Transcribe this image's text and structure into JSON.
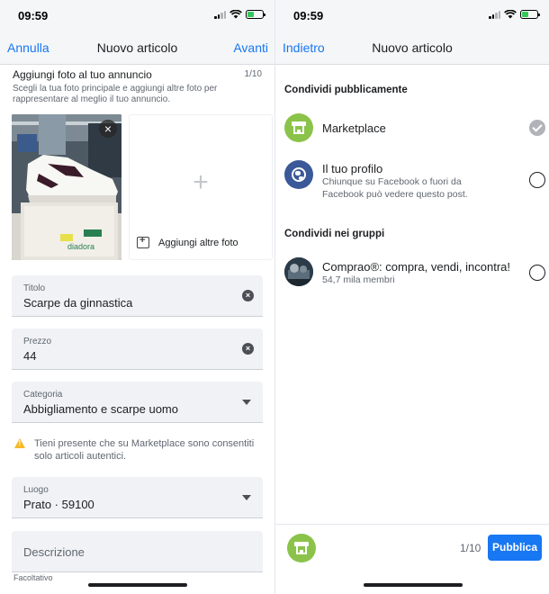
{
  "status_bar": {
    "time": "09:59"
  },
  "left": {
    "nav": {
      "cancel": "Annulla",
      "title": "Nuovo articolo",
      "next": "Avanti"
    },
    "photos": {
      "title": "Aggiungi foto al tuo annuncio",
      "count": "1/10",
      "hint": "Scegli la tua foto principale e aggiungi altre foto per rappresentare al meglio il tuo annuncio.",
      "add_more": "Aggiungi altre foto"
    },
    "fields": {
      "title": {
        "label": "Titolo",
        "value": "Scarpe da ginnastica"
      },
      "price": {
        "label": "Prezzo",
        "value": "44"
      },
      "category": {
        "label": "Categoria",
        "value": "Abbigliamento e scarpe uomo"
      },
      "location": {
        "label": "Luogo",
        "value": "Prato · 59100"
      },
      "description": {
        "placeholder": "Descrizione",
        "helper": "Facoltativo"
      }
    },
    "notice": "Tieni presente che su Marketplace sono consentiti solo articoli autentici."
  },
  "right": {
    "nav": {
      "back": "Indietro",
      "title": "Nuovo articolo"
    },
    "share_public": {
      "heading": "Condividi pubblicamente",
      "options": [
        {
          "title": "Marketplace",
          "selected": true
        },
        {
          "title": "Il tuo profilo",
          "subtitle": "Chiunque su Facebook o fuori da Facebook può vedere questo post.",
          "selected": false
        }
      ]
    },
    "share_groups": {
      "heading": "Condividi nei gruppi",
      "groups": [
        {
          "title": "Comprao®: compra, vendi, incontra!",
          "subtitle": "54,7 mila membri",
          "selected": false
        }
      ]
    },
    "bottom_bar": {
      "count": "1/10",
      "publish": "Pubblica"
    }
  },
  "colors": {
    "accent": "#1877f2",
    "marketplace_green": "#8bc34a",
    "profile_blue": "#3b5998",
    "warning": "#f7b928"
  }
}
